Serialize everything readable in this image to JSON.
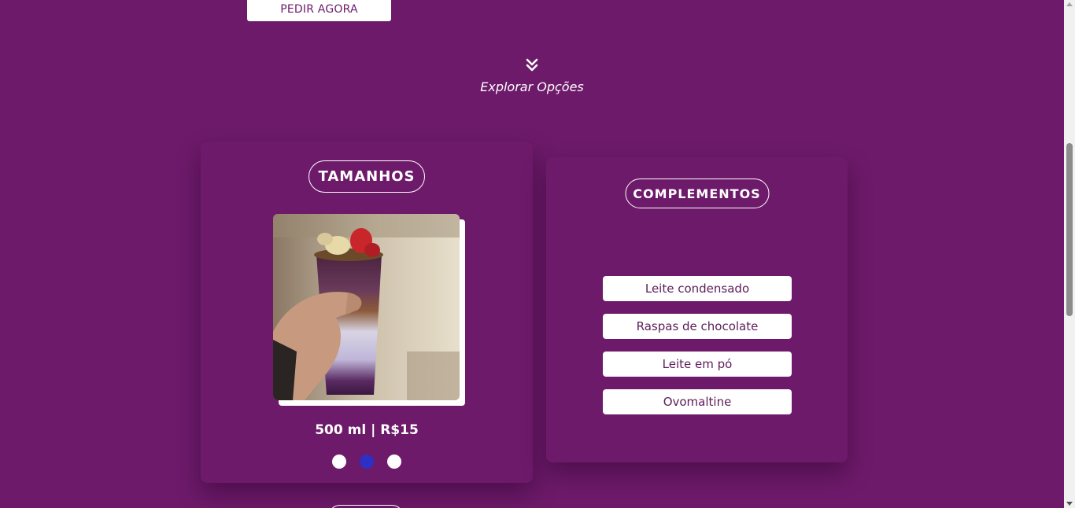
{
  "hero": {
    "order_button_label": "PEDIR AGORA"
  },
  "explore": {
    "icon": "double-chevron-down-icon",
    "label": "Explorar Opções"
  },
  "sizes": {
    "title": "TAMANHOS",
    "image": "acai-cup-photo",
    "caption": "500 ml | R$15",
    "slides": [
      {
        "active": false
      },
      {
        "active": true
      },
      {
        "active": false
      }
    ]
  },
  "complements": {
    "title": "COMPLEMENTOS",
    "options": [
      {
        "label": "Leite condensado"
      },
      {
        "label": "Raspas de chocolate"
      },
      {
        "label": "Leite em pó"
      },
      {
        "label": "Ovomaltine"
      }
    ]
  },
  "colors": {
    "background": "#6d1a6a",
    "active_dot": "#2d2fc5",
    "option_text": "#5c1c58"
  }
}
